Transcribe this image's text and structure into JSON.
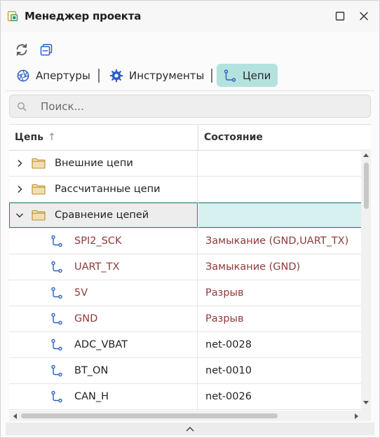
{
  "window": {
    "title": "Менеджер проекта",
    "icons": [
      "app-icon",
      "maximize-icon",
      "close-icon"
    ]
  },
  "toolbar": {
    "buttons": [
      {
        "icon": "refresh-icon"
      },
      {
        "icon": "collapse-all-icon"
      }
    ]
  },
  "tabs": [
    {
      "label": "Апертуры",
      "icon": "aperture-icon",
      "active": false
    },
    {
      "label": "Инструменты",
      "icon": "gear-icon",
      "active": false
    },
    {
      "label": "Цепи",
      "icon": "net-icon",
      "active": true
    }
  ],
  "search": {
    "placeholder": "Поиск...",
    "value": ""
  },
  "grid": {
    "columns": [
      {
        "label": "Цепь",
        "sort": "↑"
      },
      {
        "label": "Состояние"
      }
    ],
    "groups": [
      {
        "label": "Внешние цепи",
        "expanded": false
      },
      {
        "label": "Рассчитанные цепи",
        "expanded": false
      },
      {
        "label": "Сравнение цепей",
        "expanded": true,
        "selected": true
      }
    ],
    "nets": [
      {
        "name": "SPI2_SCK",
        "state": "Замыкание (GND,UART_TX)",
        "status": "error"
      },
      {
        "name": "UART_TX",
        "state": "Замыкание (GND)",
        "status": "error"
      },
      {
        "name": "5V",
        "state": "Разрыв",
        "status": "error"
      },
      {
        "name": "GND",
        "state": "Разрыв",
        "status": "error"
      },
      {
        "name": "ADC_VBAT",
        "state": "net-0028",
        "status": "ok"
      },
      {
        "name": "BT_ON",
        "state": "net-0010",
        "status": "ok"
      },
      {
        "name": "CAN_H",
        "state": "net-0026",
        "status": "ok"
      }
    ]
  },
  "colors": {
    "accent": "#1e8079",
    "active_tab": "#b4e2df",
    "selected_row": "#d6f1f0",
    "error_text": "#8f3a3a",
    "folder": "#f2dfb0"
  }
}
